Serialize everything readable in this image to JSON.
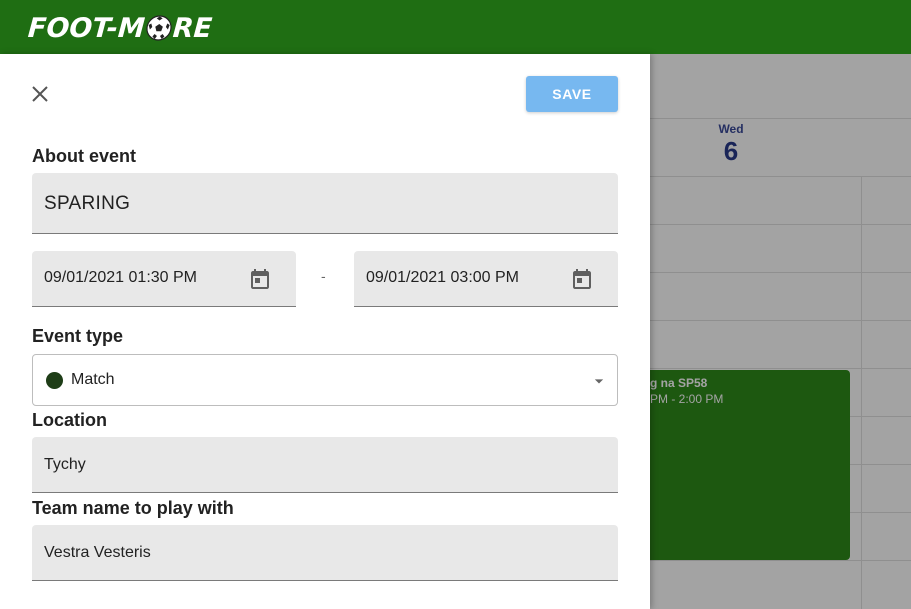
{
  "app": {
    "logo_text_left": "FOOT-M",
    "logo_text_right": "RE"
  },
  "calendar": {
    "day_name": "Wed",
    "day_number": "6",
    "event": {
      "title": "g na SP58",
      "time": "PM  -  2:00 PM",
      "color": "#2e8a1a"
    }
  },
  "form": {
    "save_label": "SAVE",
    "about_label": "About event",
    "title_value": "SPARING",
    "start_datetime": "09/01/2021 01:30 PM",
    "range_separator": "-",
    "end_datetime": "09/01/2021 03:00 PM",
    "event_type_label": "Event type",
    "event_type_value": "Match",
    "event_type_color": "#1e3d17",
    "location_label": "Location",
    "location_value": "Tychy",
    "team_label": "Team name to play with",
    "team_value": "Vestra Vesteris"
  },
  "colors": {
    "topbar": "#1f6e13",
    "save_button": "#77b8f0"
  }
}
